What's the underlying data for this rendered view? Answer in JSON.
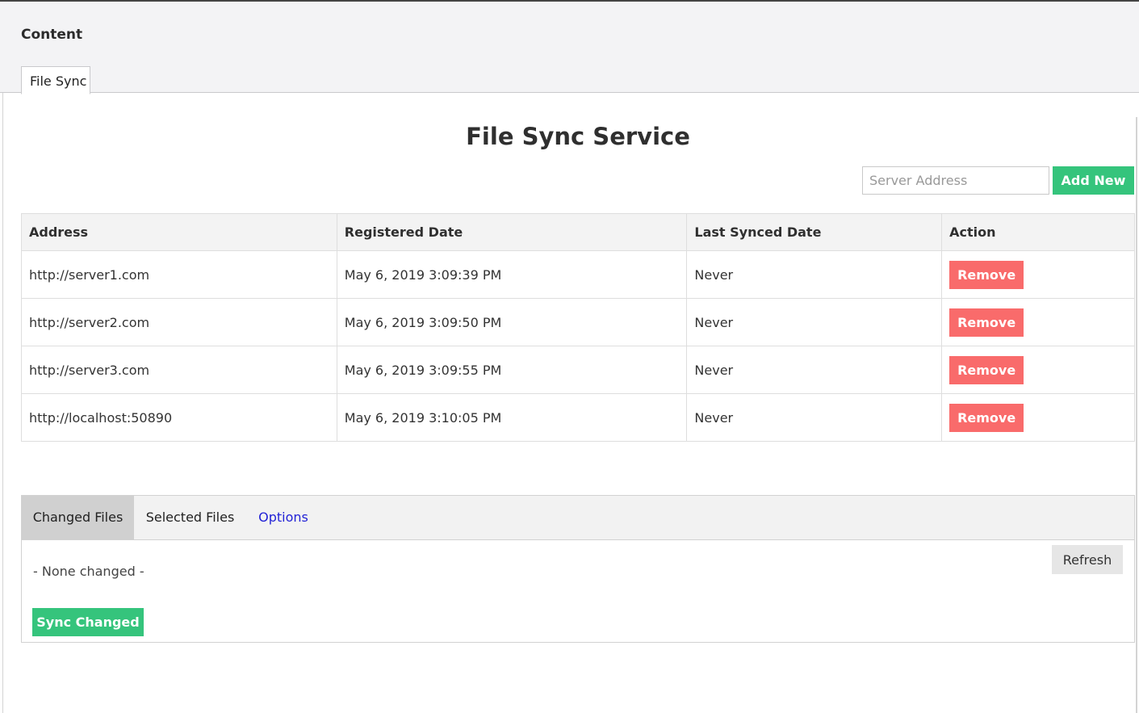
{
  "header": {
    "title": "Content",
    "tab_label": "File Sync"
  },
  "page": {
    "title": "File Sync Service"
  },
  "add_server": {
    "placeholder": "Server Address",
    "button_label": "Add New"
  },
  "servers_table": {
    "columns": [
      "Address",
      "Registered Date",
      "Last Synced Date",
      "Action"
    ],
    "rows": [
      {
        "address": "http://server1.com",
        "registered": "May 6, 2019 3:09:39 PM",
        "last_synced": "Never",
        "action": "Remove"
      },
      {
        "address": "http://server2.com",
        "registered": "May 6, 2019 3:09:50 PM",
        "last_synced": "Never",
        "action": "Remove"
      },
      {
        "address": "http://server3.com",
        "registered": "May 6, 2019 3:09:55 PM",
        "last_synced": "Never",
        "action": "Remove"
      },
      {
        "address": "http://localhost:50890",
        "registered": "May 6, 2019 3:10:05 PM",
        "last_synced": "Never",
        "action": "Remove"
      }
    ]
  },
  "files_panel": {
    "tabs": [
      {
        "label": "Changed Files",
        "active": true
      },
      {
        "label": "Selected Files",
        "active": false
      },
      {
        "label": "Options",
        "active": false
      }
    ],
    "empty_text": "- None changed -",
    "refresh_label": "Refresh",
    "sync_label": "Sync Changed"
  },
  "colors": {
    "green": "#35c47c",
    "red": "#f96b6b",
    "link": "#2323d6"
  }
}
